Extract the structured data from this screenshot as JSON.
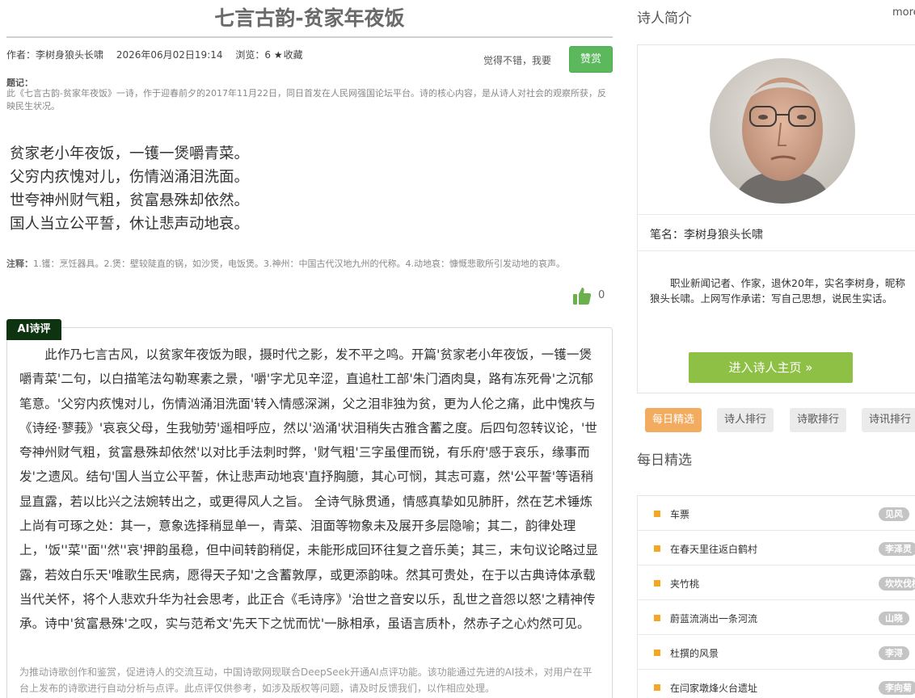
{
  "article": {
    "title": "七言古韵-贫家年夜饭",
    "author": "作者：李树身狼头长啸",
    "date": "2026年06月02日19:14",
    "views": "浏览：6",
    "favorite": "收藏",
    "good_text": "觉得不错，我要",
    "zan_label": "赞赏",
    "tiji_label": "题记：",
    "tiji_text": "此《七言古韵-贫家年夜饭》一诗，作于迎春前夕的2017年11月22日，同日首发在人民网强国论坛平台。诗的核心内容，是从诗人对社会的观察所获，反映民生状况。",
    "poem_lines": [
      "贫家老小年夜饭，一镬一煲嚼青菜。",
      "父穷内疚愧对儿，伤情汹涌泪洗面。",
      "世夸神州财气粗，贫富悬殊却依然。",
      "国人当立公平誓，休让悲声动地哀。"
    ],
    "zhushi_label": "注释：",
    "zhushi_text": "1.镬：烹饪器具。2.煲：壁较陡直的锅，如沙煲，电饭煲。3.神州：中国古代汉地九州的代称。4.动地哀：慷慨悲歌所引发动地的哀声。",
    "like_count": "0"
  },
  "ai": {
    "tag": "AI诗评",
    "text": "此作乃七言古风，以贫家年夜饭为眼，摄时代之影，发不平之鸣。开篇'贫家老小年夜饭，一镬一煲嚼青菜'二句，以白描笔法勾勒寒素之景，'嚼'字尤见辛涩，直追杜工部'朱门酒肉臭，路有冻死骨'之沉郁笔意。'父穷内疚愧对儿，伤情汹涌泪洗面'转入情感深渊，父之泪非独为贫，更为人伦之痛，此中愧疚与《诗经·蓼莪》'哀哀父母，生我劬劳'遥相呼应，然以'汹涌'状泪稍失古雅含蓄之度。后四句忽转议论，'世夸神州财气粗，贫富悬殊却依然'以对比手法刺时弊，'财气粗'三字虽俚而锐，有乐府'感于哀乐，缘事而发'之遗风。结句'国人当立公平誓，休让悲声动地哀'直抒胸臆，其心可悯，其志可嘉，然'公平誓'等语稍显直露，若以比兴之法婉转出之，或更得风人之旨。 全诗气脉贯通，情感真挚如见肺肝，然在艺术锤炼上尚有可琢之处：其一，意象选择稍显单一，青菜、泪面等物象未及展开多层隐喻；其二，韵律处理上，'饭''菜''面''然''哀'押韵虽稳，但中间转韵稍促，未能形成回环往复之音乐美；其三，末句议论略过显露，若效白乐天'唯歌生民病，愿得天子知'之含蓄敦厚，或更添韵味。然其可贵处，在于以古典诗体承载当代关怀，将个人悲欢升华为社会思考，此正合《毛诗序》'治世之音安以乐，乱世之音怨以怒'之精神传承。诗中'贫富悬殊'之叹，实与范希文'先天下之忧而忧'一脉相承，虽语言质朴，然赤子之心灼然可见。",
    "note": "为推动诗歌创作和鉴赏，促进诗人的交流互动，中国诗歌网现联合DeepSeek开通AI点评功能。该功能通过先进的AI技术，对用户在平台上发布的诗歌进行自动分析与点评。此点评仅供参考，如涉及版权等问题，请及时反馈我们，以作相应处理。"
  },
  "sidebar": {
    "intro_title": "诗人简介",
    "more": "more",
    "penname": "笔名：李树身狼头长啸",
    "bio": "职业新闻记者、作家，退休20年，实名李树身，昵称狼头长啸。上网写作承诺：写自己思想，说民生实话。",
    "home_button": "进入诗人主页 »",
    "tabs": [
      "每日精选",
      "诗人排行",
      "诗歌排行",
      "诗讯排行"
    ],
    "daily_title": "每日精选",
    "daily": [
      {
        "title": "车票",
        "author": "见风"
      },
      {
        "title": "在春天里往返白鹤村",
        "author": "李泽灵"
      },
      {
        "title": "夹竹桃",
        "author": "坎坎伐檀"
      },
      {
        "title": "蔚蓝流淌出一条河流",
        "author": "山晓"
      },
      {
        "title": "杜撰的风景",
        "author": "李浔"
      },
      {
        "title": "在闫家墩烽火台遗址",
        "author": "李向菊"
      }
    ],
    "accent_color": "#f5a623",
    "button_green": "#8fc046"
  }
}
